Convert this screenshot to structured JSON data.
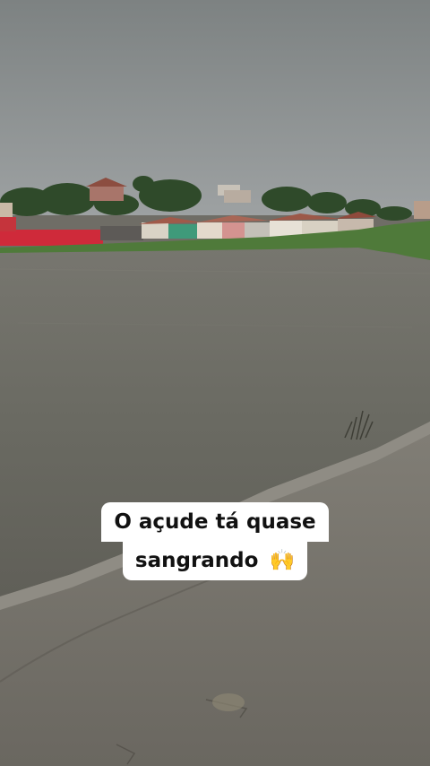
{
  "caption": {
    "line1": "O açude tá quase",
    "line2": "sangrando",
    "emoji": "🙌"
  },
  "colors": {
    "sky": "#8a8e8f",
    "water": "#6b6b62",
    "grass": "#4f7a3a",
    "concrete": "#7a776f",
    "red_wall": "#d0283a"
  }
}
